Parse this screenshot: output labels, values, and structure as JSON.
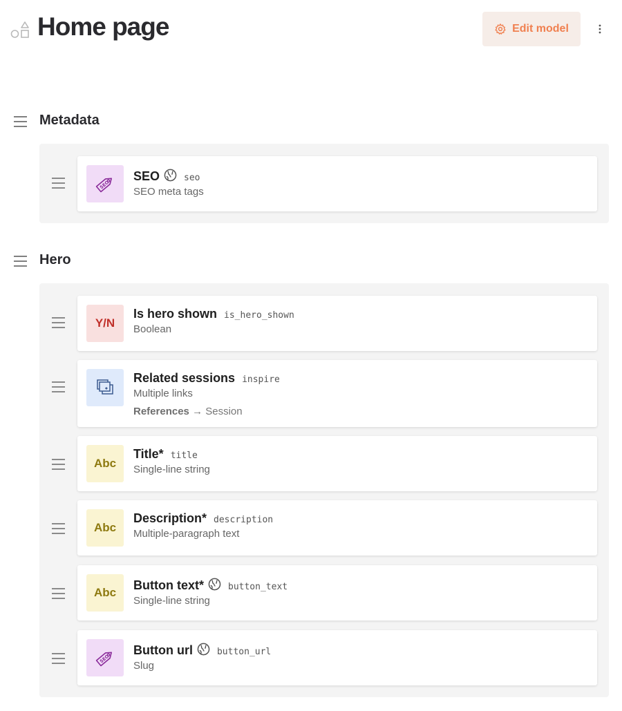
{
  "header": {
    "title": "Home page",
    "edit_label": "Edit model",
    "accent_color": "#f08050"
  },
  "groups": [
    {
      "title": "Metadata",
      "fields": [
        {
          "name": "SEO",
          "localized": true,
          "key": "seo",
          "type": "SEO meta tags",
          "icon": "seo-tag-icon",
          "icon_text": ""
        }
      ]
    },
    {
      "title": "Hero",
      "fields": [
        {
          "name": "Is hero shown",
          "localized": false,
          "key": "is_hero_shown",
          "type": "Boolean",
          "icon": "boolean-icon",
          "icon_text": "Y/N"
        },
        {
          "name": "Related sessions",
          "localized": false,
          "key": "inspire",
          "type": "Multiple links",
          "icon": "links-icon",
          "icon_text": "",
          "references_label": "References",
          "references_target": "→ Session"
        },
        {
          "name": "Title*",
          "localized": false,
          "key": "title",
          "type": "Single-line string",
          "icon": "string-icon",
          "icon_text": "Abc"
        },
        {
          "name": "Description*",
          "localized": false,
          "key": "description",
          "type": "Multiple-paragraph text",
          "icon": "text-icon",
          "icon_text": "Abc"
        },
        {
          "name": "Button text*",
          "localized": true,
          "key": "button_text",
          "type": "Single-line string",
          "icon": "string-icon",
          "icon_text": "Abc"
        },
        {
          "name": "Button url",
          "localized": true,
          "key": "button_url",
          "type": "Slug",
          "icon": "slug-icon",
          "icon_text": ""
        }
      ]
    }
  ]
}
